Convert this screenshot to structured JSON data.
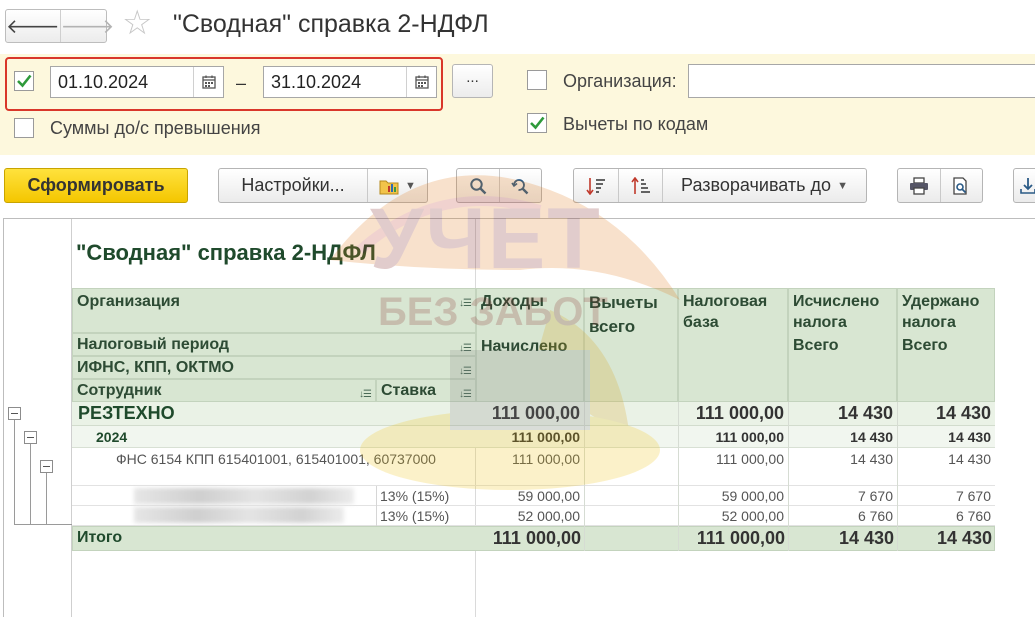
{
  "window": {
    "title": "\"Сводная\" справка 2-НДФЛ",
    "back_glyph": "🡐",
    "forward_glyph": "🡒",
    "star_glyph": "☆"
  },
  "filters": {
    "period_checked": true,
    "date_from": "01.10.2024",
    "date_separator": "–",
    "date_to": "31.10.2024",
    "select_period_label": "...",
    "organization_label": "Организация:",
    "organization_value": "",
    "organization_checked": false,
    "exceed_label": "Суммы до/с превышения",
    "exceed_checked": false,
    "deductions_label": "Вычеты по кодам",
    "deductions_checked": true
  },
  "toolbar": {
    "generate_label": "Сформировать",
    "settings_label": "Настройки...",
    "expand_label": "Разворачивать до"
  },
  "report": {
    "title": "\"Сводная\" справка 2-НДФЛ",
    "headers": {
      "organization": "Организация",
      "tax_period": "Налоговый период",
      "ifns": "ИФНС, КПП, ОКТМО",
      "employee": "Сотрудник",
      "rate": "Ставка",
      "income": "Доходы",
      "income_sub": "Начислено",
      "deductions": "Вычеты всего",
      "tax_base": "Налоговая база",
      "calculated": "Исчислено налога",
      "calculated_sub": "Всего",
      "withheld": "Удержано налога",
      "withheld_sub": "Всего"
    },
    "rows": {
      "org": {
        "name": "РЕЗТЕХНО",
        "income": "111 000,00",
        "tax_base": "111 000,00",
        "calculated": "14 430",
        "withheld": "14 430"
      },
      "year": {
        "name": "2024",
        "income": "111 000,00",
        "tax_base": "111 000,00",
        "calculated": "14 430",
        "withheld": "14 430"
      },
      "ifns": {
        "name": "ФНС 6154 КПП 615401001, 615401001, 60737000",
        "income": "111 000,00",
        "tax_base": "111 000,00",
        "calculated": "14 430",
        "withheld": "14 430"
      },
      "emp1": {
        "rate": "13% (15%)",
        "income": "59 000,00",
        "tax_base": "59 000,00",
        "calculated": "7 670",
        "withheld": "7 670"
      },
      "emp2": {
        "rate": "13% (15%)",
        "income": "52 000,00",
        "tax_base": "52 000,00",
        "calculated": "6 760",
        "withheld": "6 760"
      },
      "total": {
        "name": "Итого",
        "income": "111 000,00",
        "tax_base": "111 000,00",
        "calculated": "14 430",
        "withheld": "14 430"
      }
    }
  },
  "watermark": {
    "line1": "УЧЕТ",
    "line2": "БЕЗ ЗАБОТ"
  },
  "colors": {
    "accent_yellow": "#f4c600",
    "filter_bg": "#fdf8dd",
    "header_green": "#d8e6d2",
    "highlight_red": "#d9372a"
  }
}
